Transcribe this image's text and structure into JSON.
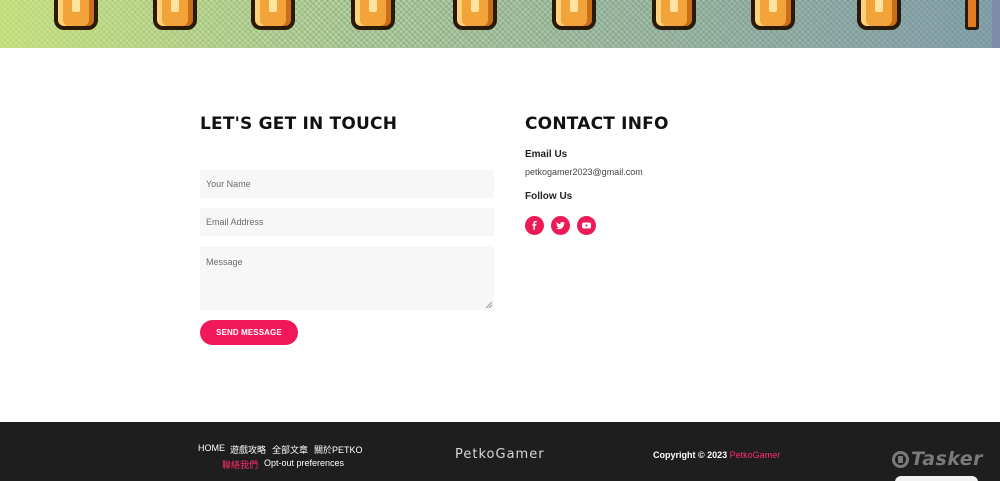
{
  "contact": {
    "title": "LET'S GET IN TOUCH",
    "name_placeholder": "Your Name",
    "email_placeholder": "Email Address",
    "message_placeholder": "Message",
    "send_label": "SEND MESSAGE"
  },
  "info": {
    "title": "CONTACT INFO",
    "email_label": "Email Us",
    "email_value": "petkogamer2023@gmail.com",
    "follow_label": "Follow Us",
    "social_icons": [
      "facebook-icon",
      "twitter-icon",
      "youtube-icon"
    ]
  },
  "footer": {
    "nav": [
      "HOME",
      "遊戲攻略",
      "全部文章",
      "關於PETKO"
    ],
    "nav2": [
      "聯絡我們",
      "Opt-out preferences"
    ],
    "brand": "PetkoGamer",
    "copyright_prefix": "Copyright © 2023",
    "copyright_brand": "PetkoGamer",
    "watermark": "Tasker"
  },
  "colors": {
    "accent": "#f0185a",
    "footer_bg": "#1e1e1e"
  }
}
